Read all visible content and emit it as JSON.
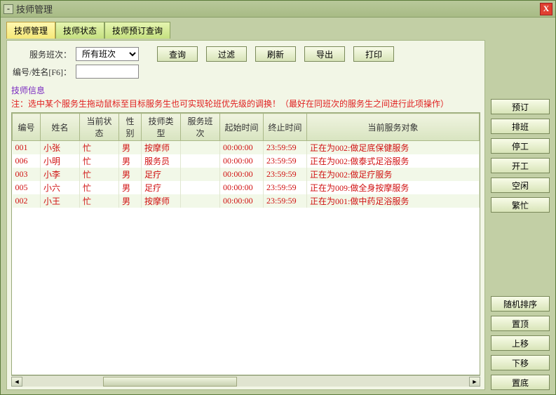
{
  "window": {
    "title": "技师管理",
    "min_glyph": "-",
    "close_glyph": "X"
  },
  "tabs": [
    {
      "label": "技师管理",
      "active": true
    },
    {
      "label": "技师状态",
      "active": false
    },
    {
      "label": "技师预订查询",
      "active": false
    }
  ],
  "form": {
    "shift_label": "服务班次：",
    "shift_value": "所有班次",
    "id_label": "编号/姓名[F6]：",
    "id_value": ""
  },
  "toolbar": {
    "query": "查询",
    "filter": "过滤",
    "refresh": "刷新",
    "export": "导出",
    "print": "打印"
  },
  "fieldset_label": "技师信息",
  "note": "注：选中某个服务生拖动鼠标至目标服务生也可实现轮班优先级的调换！（最好在同班次的服务生之间进行此项操作）",
  "columns": {
    "id": "编号",
    "name": "姓名",
    "state": "当前状态",
    "sex": "性别",
    "type": "技师类型",
    "shift": "服务班次",
    "start": "起始时间",
    "end": "终止时间",
    "target": "当前服务对象"
  },
  "rows": [
    {
      "id": "001",
      "name": "小张",
      "state": "忙",
      "sex": "男",
      "type": "按摩师",
      "shift": "",
      "start": "00:00:00",
      "end": "23:59:59",
      "target": "正在为002:做足底保健服务"
    },
    {
      "id": "006",
      "name": "小明",
      "state": "忙",
      "sex": "男",
      "type": "服务员",
      "shift": "",
      "start": "00:00:00",
      "end": "23:59:59",
      "target": "正在为002:做泰式足浴服务"
    },
    {
      "id": "003",
      "name": "小李",
      "state": "忙",
      "sex": "男",
      "type": "足疗",
      "shift": "",
      "start": "00:00:00",
      "end": "23:59:59",
      "target": "正在为002:做足疗服务"
    },
    {
      "id": "005",
      "name": "小六",
      "state": "忙",
      "sex": "男",
      "type": "足疗",
      "shift": "",
      "start": "00:00:00",
      "end": "23:59:59",
      "target": "正在为009:做全身按摩服务"
    },
    {
      "id": "002",
      "name": "小王",
      "state": "忙",
      "sex": "男",
      "type": "按摩师",
      "shift": "",
      "start": "00:00:00",
      "end": "23:59:59",
      "target": "正在为001:做中药足浴服务"
    }
  ],
  "side": {
    "book": "预订",
    "schedule": "排班",
    "stop": "停工",
    "start": "开工",
    "idle": "空闲",
    "busy": "繁忙",
    "random": "随机排序",
    "top": "置顶",
    "up": "上移",
    "down": "下移",
    "bottom": "置底"
  },
  "scroll": {
    "left": "◄",
    "right": "►"
  }
}
